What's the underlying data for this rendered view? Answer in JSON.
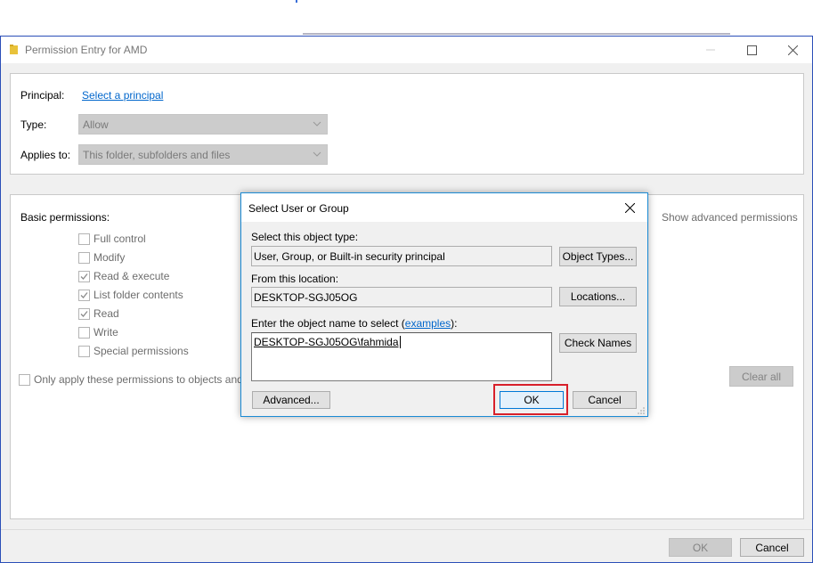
{
  "window": {
    "title": "Permission Entry for AMD",
    "icons": {
      "folder": "folder-icon",
      "minimize": "minimize-icon",
      "maximize": "maximize-icon",
      "close": "close-icon"
    }
  },
  "principal": {
    "label": "Principal:",
    "link": "Select a principal"
  },
  "type": {
    "label": "Type:",
    "value": "Allow"
  },
  "applies_to": {
    "label": "Applies to:",
    "value": "This folder, subfolders and files"
  },
  "permissions": {
    "heading": "Basic permissions:",
    "advanced_link": "Show advanced permissions",
    "items": [
      {
        "label": "Full control",
        "checked": false
      },
      {
        "label": "Modify",
        "checked": false
      },
      {
        "label": "Read & execute",
        "checked": true
      },
      {
        "label": "List folder contents",
        "checked": true
      },
      {
        "label": "Read",
        "checked": true
      },
      {
        "label": "Write",
        "checked": false
      },
      {
        "label": "Special permissions",
        "checked": false
      }
    ],
    "only_apply_label": "Only apply these permissions to objects and/",
    "clear_all": "Clear all"
  },
  "footer": {
    "ok": "OK",
    "cancel": "Cancel"
  },
  "dialog": {
    "title": "Select User or Group",
    "object_type_label": "Select this object type:",
    "object_type_value": "User, Group, or Built-in security principal",
    "object_types_button": "Object Types...",
    "location_label": "From this location:",
    "location_value": "DESKTOP-SGJ05OG",
    "locations_button": "Locations...",
    "enter_name_label_prefix": "Enter the object name to select (",
    "examples_link": "examples",
    "enter_name_label_suffix": "):",
    "object_name_value": "DESKTOP-SGJ05OG\\fahmida",
    "check_names_button": "Check Names",
    "advanced_button": "Advanced...",
    "ok_button": "OK",
    "cancel_button": "Cancel",
    "highlight_color": "#d8202a",
    "accent_color": "#1a8ad4"
  }
}
